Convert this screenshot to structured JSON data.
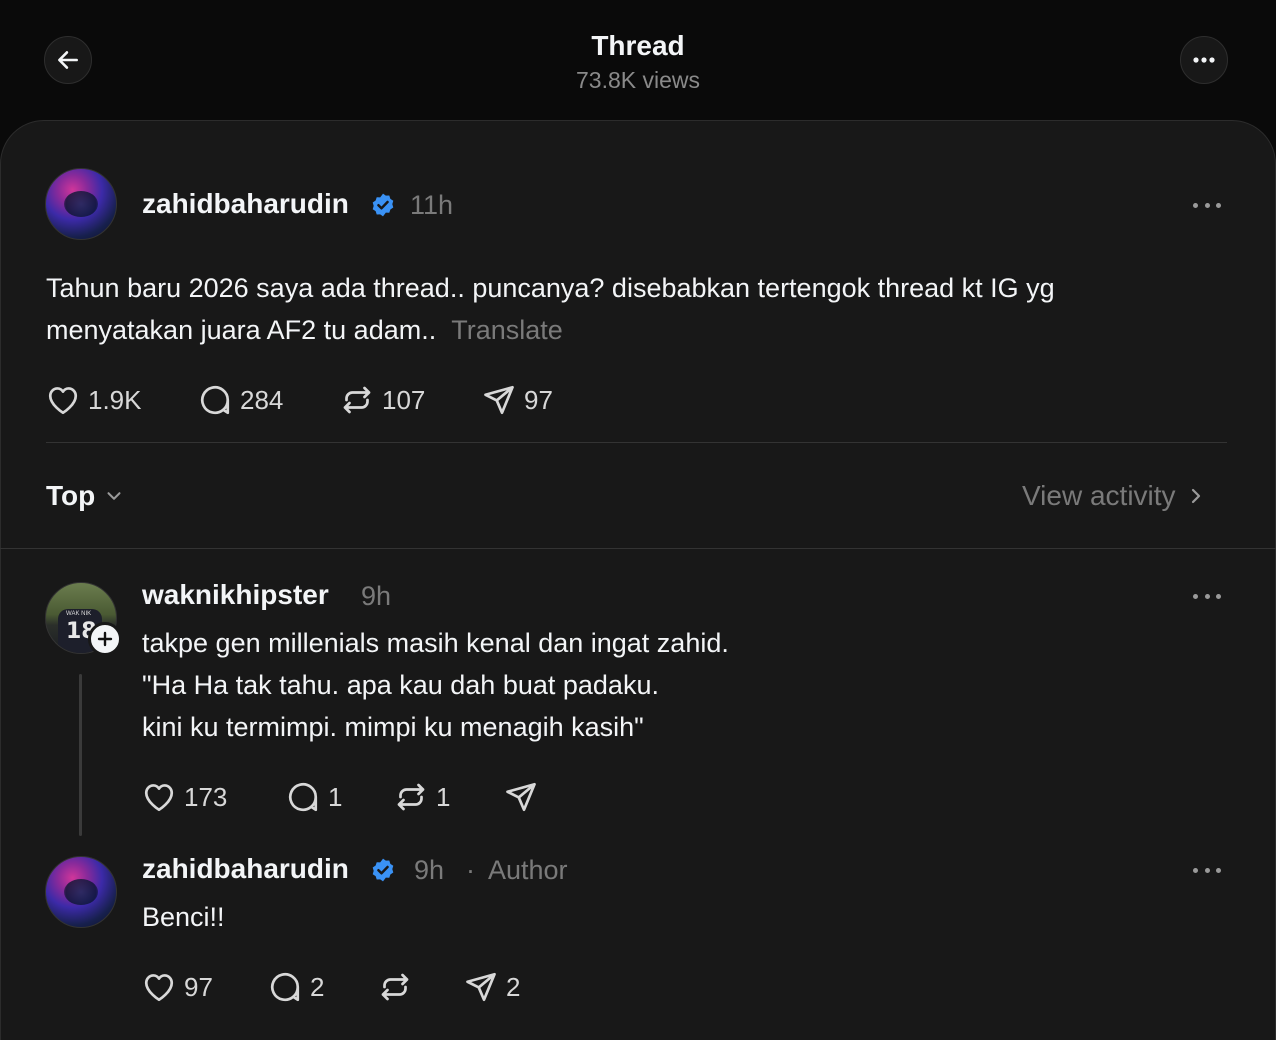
{
  "header": {
    "title": "Thread",
    "views": "73.8K views"
  },
  "post": {
    "username": "zahidbaharudin",
    "time": "11h",
    "text_line1": "Tahun baru 2026 saya ada thread.. puncanya? disebabkan tertengok thread kt IG yg",
    "text_line2": "menyatakan juara AF2 tu adam..",
    "translate": "Translate",
    "likes": "1.9K",
    "replies": "284",
    "reposts": "107",
    "shares": "97"
  },
  "sort": {
    "label": "Top",
    "view_activity": "View activity"
  },
  "replies": [
    {
      "username": "waknikhipster",
      "time": "9h",
      "lines": [
        "takpe gen millenials masih kenal dan ingat zahid.",
        "\"Ha Ha tak tahu. apa kau dah buat padaku.",
        "kini ku termimpi. mimpi ku menagih kasih\""
      ],
      "likes": "173",
      "replies": "1",
      "reposts": "1",
      "shares": "",
      "avatar_jersey_number": "18",
      "avatar_jersey_name": "WAK NIK"
    },
    {
      "username": "zahidbaharudin",
      "time": "9h",
      "separator": "·",
      "tag": "Author",
      "text": "Benci!!",
      "likes": "97",
      "replies": "2",
      "reposts": "",
      "shares": "2"
    }
  ],
  "colors": {
    "background": "#0a0a0a",
    "panel": "#181818",
    "verified": "#3a92f5",
    "muted": "#7a7a7a"
  }
}
